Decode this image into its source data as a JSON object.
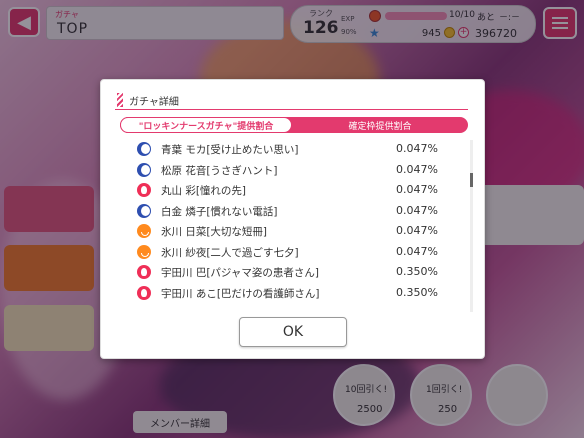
{
  "header": {
    "caption": "ガチャ",
    "title": "TOP"
  },
  "status": {
    "rank_label": "ランク",
    "rank": "126",
    "exp_label": "EXP",
    "exp_percent": "90%",
    "life": "10/10",
    "life_next_label": "あと",
    "life_timer": "－:－",
    "stars": "945",
    "coins": "396720"
  },
  "background": {
    "member_button": "メンバー詳細",
    "pull10_label": "10回引く!",
    "pull10_cost": "2500",
    "pull1_label": "1回引く!",
    "pull1_cost": "250"
  },
  "modal": {
    "title": "ガチャ詳細",
    "tabs": [
      {
        "label": "\"ロッキンナースガチャ\"提供割合",
        "active": true
      },
      {
        "label": "確定枠提供割合",
        "active": false
      }
    ],
    "rows": [
      {
        "attr": "cool",
        "name": "青葉 モカ[受け止めたい思い]",
        "rate": "0.047%"
      },
      {
        "attr": "cool",
        "name": "松原 花音[うさぎハント]",
        "rate": "0.047%"
      },
      {
        "attr": "power",
        "name": "丸山 彩[憧れの先]",
        "rate": "0.047%"
      },
      {
        "attr": "cool",
        "name": "白金 燐子[慣れない電話]",
        "rate": "0.047%"
      },
      {
        "attr": "pure",
        "name": "氷川 日菜[大切な短冊]",
        "rate": "0.047%"
      },
      {
        "attr": "pure",
        "name": "氷川 紗夜[二人で過ごす七夕]",
        "rate": "0.047%"
      },
      {
        "attr": "power",
        "name": "宇田川 巴[パジャマ姿の患者さん]",
        "rate": "0.350%"
      },
      {
        "attr": "power",
        "name": "宇田川 あこ[巴だけの看護師さん]",
        "rate": "0.350%"
      }
    ],
    "ok_label": "OK"
  },
  "colors": {
    "accent": "#e33a6e",
    "cool": "#2e4fb0",
    "pure": "#ff8a1e",
    "power": "#ef2f57"
  }
}
